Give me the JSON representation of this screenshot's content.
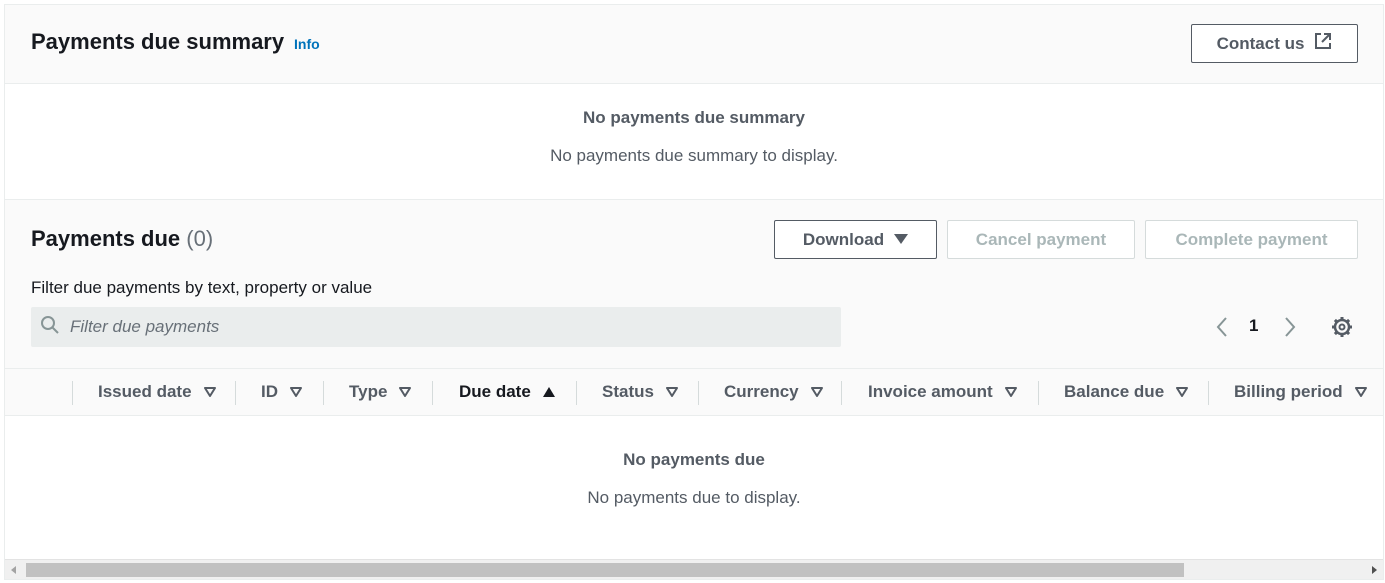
{
  "summary": {
    "title": "Payments due summary",
    "info_label": "Info",
    "contact_label": "Contact us",
    "empty_title": "No payments due summary",
    "empty_text": "No payments due summary to display."
  },
  "payments_due": {
    "title": "Payments due",
    "count": "(0)",
    "download_label": "Download",
    "cancel_label": "Cancel payment",
    "complete_label": "Complete payment",
    "filter_label": "Filter due payments by text, property or value",
    "filter_placeholder": "Filter due payments",
    "current_page": "1"
  },
  "table": {
    "columns": [
      {
        "label": "Issued date",
        "sort": "none"
      },
      {
        "label": "ID",
        "sort": "none"
      },
      {
        "label": "Type",
        "sort": "none"
      },
      {
        "label": "Due date",
        "sort": "ascending"
      },
      {
        "label": "Status",
        "sort": "none"
      },
      {
        "label": "Currency",
        "sort": "none"
      },
      {
        "label": "Invoice amount",
        "sort": "none"
      },
      {
        "label": "Balance due",
        "sort": "none"
      },
      {
        "label": "Billing period",
        "sort": "none"
      }
    ],
    "empty_title": "No payments due",
    "empty_text": "No payments due to display."
  },
  "colors": {
    "link": "#0073bb",
    "text": "#16191f",
    "muted": "#545b64",
    "disabled": "#aab7b8"
  }
}
